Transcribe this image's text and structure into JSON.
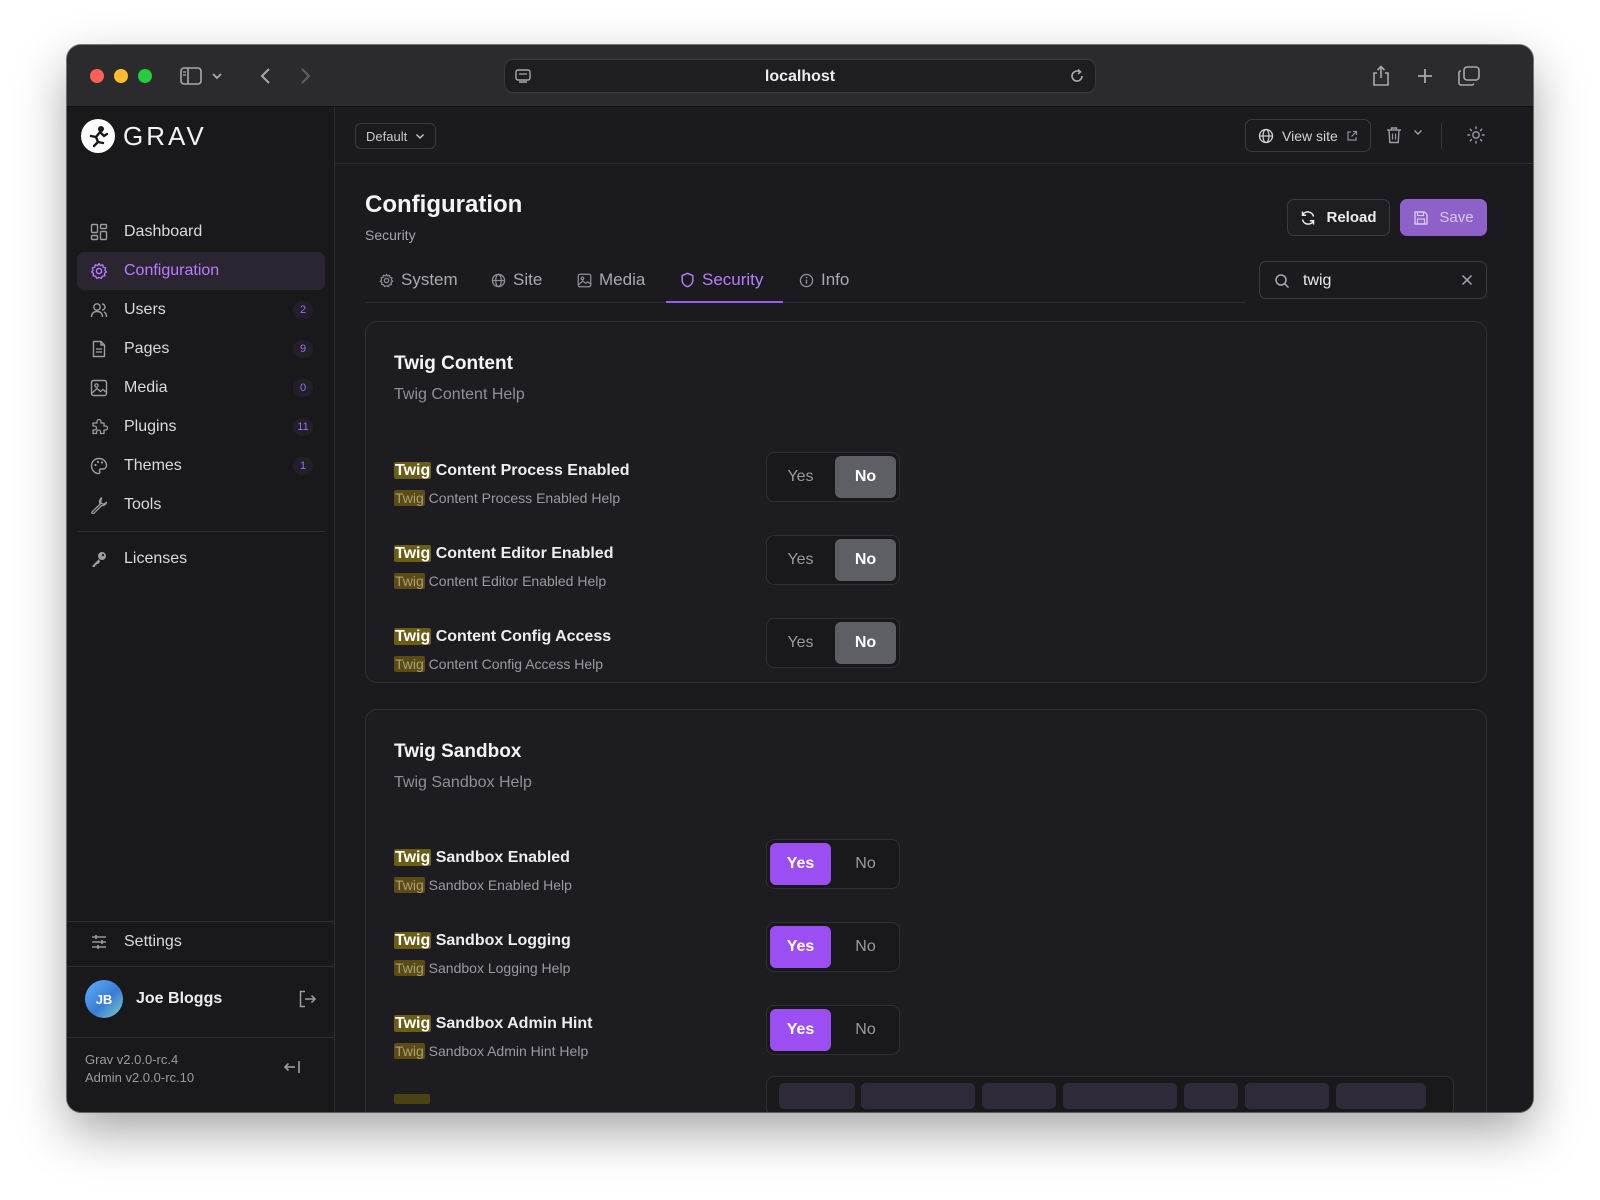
{
  "browser": {
    "url": "localhost"
  },
  "app": {
    "logo_text": "GRAV"
  },
  "sidebar": {
    "items": [
      {
        "label": "Dashboard",
        "icon": "dashboard-icon"
      },
      {
        "label": "Configuration",
        "icon": "gear-icon",
        "active": true
      },
      {
        "label": "Users",
        "icon": "users-icon",
        "count": "2"
      },
      {
        "label": "Pages",
        "icon": "page-icon",
        "count": "9"
      },
      {
        "label": "Media",
        "icon": "image-icon",
        "count": "0"
      },
      {
        "label": "Plugins",
        "icon": "puzzle-icon",
        "count": "11"
      },
      {
        "label": "Themes",
        "icon": "palette-icon",
        "count": "1"
      },
      {
        "label": "Tools",
        "icon": "wrench-icon"
      }
    ],
    "licenses_label": "Licenses",
    "settings_label": "Settings",
    "user": {
      "initials": "JB",
      "name": "Joe Bloggs"
    },
    "version_grav": "Grav v2.0.0-rc.4",
    "version_admin": "Admin v2.0.0-rc.10"
  },
  "topbar": {
    "environment": "Default",
    "view_site_label": "View site"
  },
  "header": {
    "title": "Configuration",
    "subtitle": "Security",
    "reload_label": "Reload",
    "save_label": "Save"
  },
  "tabs": [
    {
      "label": "System",
      "icon": "gear-icon"
    },
    {
      "label": "Site",
      "icon": "globe-icon"
    },
    {
      "label": "Media",
      "icon": "image-icon"
    },
    {
      "label": "Security",
      "icon": "shield-icon",
      "active": true
    },
    {
      "label": "Info",
      "icon": "info-icon"
    }
  ],
  "search": {
    "value": "twig"
  },
  "sections": [
    {
      "title": "Twig Content",
      "help": "Twig Content Help",
      "fields": [
        {
          "highlight": "Twig",
          "label_rest": " Content Process Enabled",
          "help_rest": " Content Process Enabled Help",
          "value": "No"
        },
        {
          "highlight": "Twig",
          "label_rest": " Content Editor Enabled",
          "help_rest": " Content Editor Enabled Help",
          "value": "No"
        },
        {
          "highlight": "Twig",
          "label_rest": " Content Config Access",
          "help_rest": " Content Config Access Help",
          "value": "No"
        }
      ]
    },
    {
      "title": "Twig Sandbox",
      "help": "Twig Sandbox Help",
      "fields": [
        {
          "highlight": "Twig",
          "label_rest": " Sandbox Enabled",
          "help_rest": " Sandbox Enabled Help",
          "value": "Yes"
        },
        {
          "highlight": "Twig",
          "label_rest": " Sandbox Logging",
          "help_rest": " Sandbox Logging Help",
          "value": "Yes"
        },
        {
          "highlight": "Twig",
          "label_rest": " Sandbox Admin Hint",
          "help_rest": " Sandbox Admin Hint Help",
          "value": "Yes"
        }
      ]
    }
  ],
  "toggle_labels": {
    "yes": "Yes",
    "no": "No"
  },
  "colors": {
    "accent": "#9b4ff2",
    "highlight": "#6b5c16",
    "background": "#1b1b1f"
  }
}
